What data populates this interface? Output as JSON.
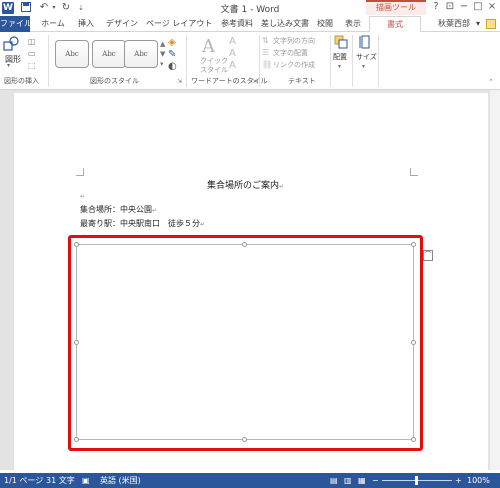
{
  "titlebar": {
    "title": "文書 1 - Word",
    "tools_tab": "描画ツール",
    "help": "?",
    "ribbon_display": "⊡",
    "minimize": "−",
    "restore": "□",
    "close": "×"
  },
  "tabs": {
    "file": "ファイル",
    "home": "ホーム",
    "insert": "挿入",
    "design": "デザイン",
    "page_layout": "ページ レイアウト",
    "references": "参考資料",
    "mailings": "差し込み文書",
    "review": "校閲",
    "view": "表示",
    "format": "書式",
    "user": "秋葉西部"
  },
  "ribbon": {
    "insert_shapes": {
      "shapes_label": "図形",
      "group_label": "図形の挿入"
    },
    "shape_styles": {
      "preset_label": "Abc",
      "group_label": "図形のスタイル"
    },
    "wordart": {
      "quick_styles_label_1": "クイック",
      "quick_styles_label_2": "スタイル",
      "group_label": "ワードアートのスタイル"
    },
    "text": {
      "direction": "文字列の方向",
      "align": "文字の配置",
      "link": "リンクの作成",
      "group_label": "テキスト"
    },
    "arrange": {
      "label": "配置"
    },
    "size": {
      "label": "サイズ"
    }
  },
  "document": {
    "title": "集合場所のご案内",
    "location_line": "集合場所：中央公園",
    "station_line": "最寄り駅：中央駅南口　徒歩５分",
    "paragraph_mark": "↵"
  },
  "statusbar": {
    "page": "1/1 ページ",
    "words": "31 文字",
    "language": "英語 (米国)",
    "zoom": "100%"
  }
}
